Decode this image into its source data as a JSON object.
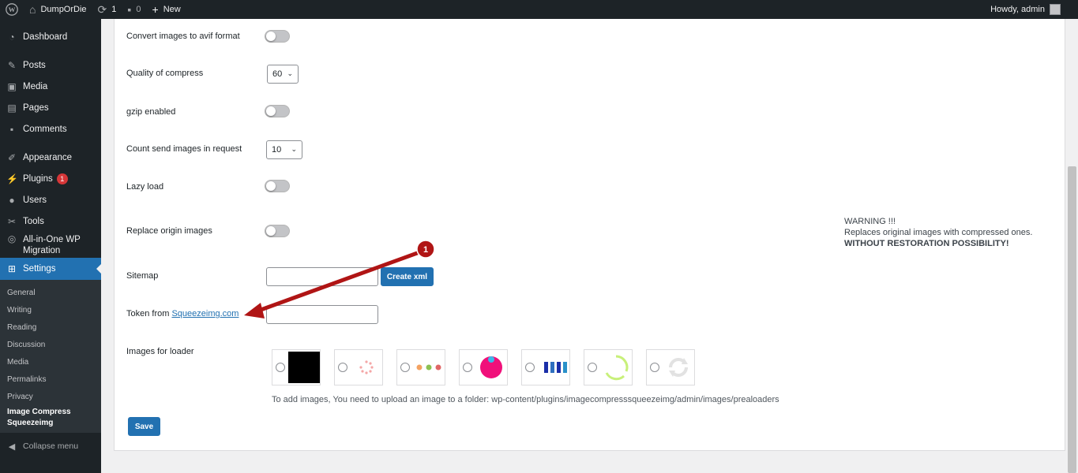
{
  "adminbar": {
    "site_name": "DumpOrDie",
    "updates_count": "1",
    "comments_count": "0",
    "new_label": "New",
    "howdy": "Howdy, admin"
  },
  "sidebar": {
    "items": [
      {
        "label": "Dashboard",
        "icon": "dashboard-icon"
      },
      {
        "label": "Posts",
        "icon": "pin-icon"
      },
      {
        "label": "Media",
        "icon": "media-icon"
      },
      {
        "label": "Pages",
        "icon": "pages-icon"
      },
      {
        "label": "Comments",
        "icon": "comment-icon"
      },
      {
        "label": "Appearance",
        "icon": "brush-icon"
      },
      {
        "label": "Plugins",
        "icon": "plugin-icon",
        "badge": "1"
      },
      {
        "label": "Users",
        "icon": "users-icon"
      },
      {
        "label": "Tools",
        "icon": "wrench-icon"
      },
      {
        "label": "All-in-One WP Migration",
        "icon": "migration-icon"
      },
      {
        "label": "Settings",
        "icon": "settings-icon"
      }
    ],
    "submenu": [
      "General",
      "Writing",
      "Reading",
      "Discussion",
      "Media",
      "Permalinks",
      "Privacy",
      "Image Compress Squeezeimg"
    ],
    "collapse_label": "Collapse menu"
  },
  "settings": {
    "avif_label": "Convert images to avif format",
    "quality_label": "Quality of compress",
    "quality_value": "60",
    "gzip_label": "gzip enabled",
    "count_label": "Count send images in request",
    "count_value": "10",
    "lazy_label": "Lazy load",
    "replace_label": "Replace origin images",
    "sitemap_label": "Sitemap",
    "sitemap_value": "",
    "create_xml_label": "Create xml",
    "token_label_prefix": "Token from ",
    "token_link": "Squeezeimg.com",
    "token_value": "",
    "loader_label": "Images for loader",
    "loader_hint": "To add images, You need to upload an image to a folder: wp-content/plugins/imagecompresssqueezeimg/admin/images/prealoaders",
    "save_label": "Save",
    "toggles": {
      "avif": false,
      "gzip": false,
      "lazy": false,
      "replace": false
    }
  },
  "warning": {
    "line1": "WARNING !!!",
    "line2": "Replaces original images with compressed ones.",
    "line3": "WITHOUT RESTORATION POSSIBILITY!"
  },
  "annotation": {
    "marker": "1",
    "color": "#b01515"
  },
  "colors": {
    "accent": "#2271b1",
    "sidebar_bg": "#1d2327",
    "badge": "#d63638"
  }
}
